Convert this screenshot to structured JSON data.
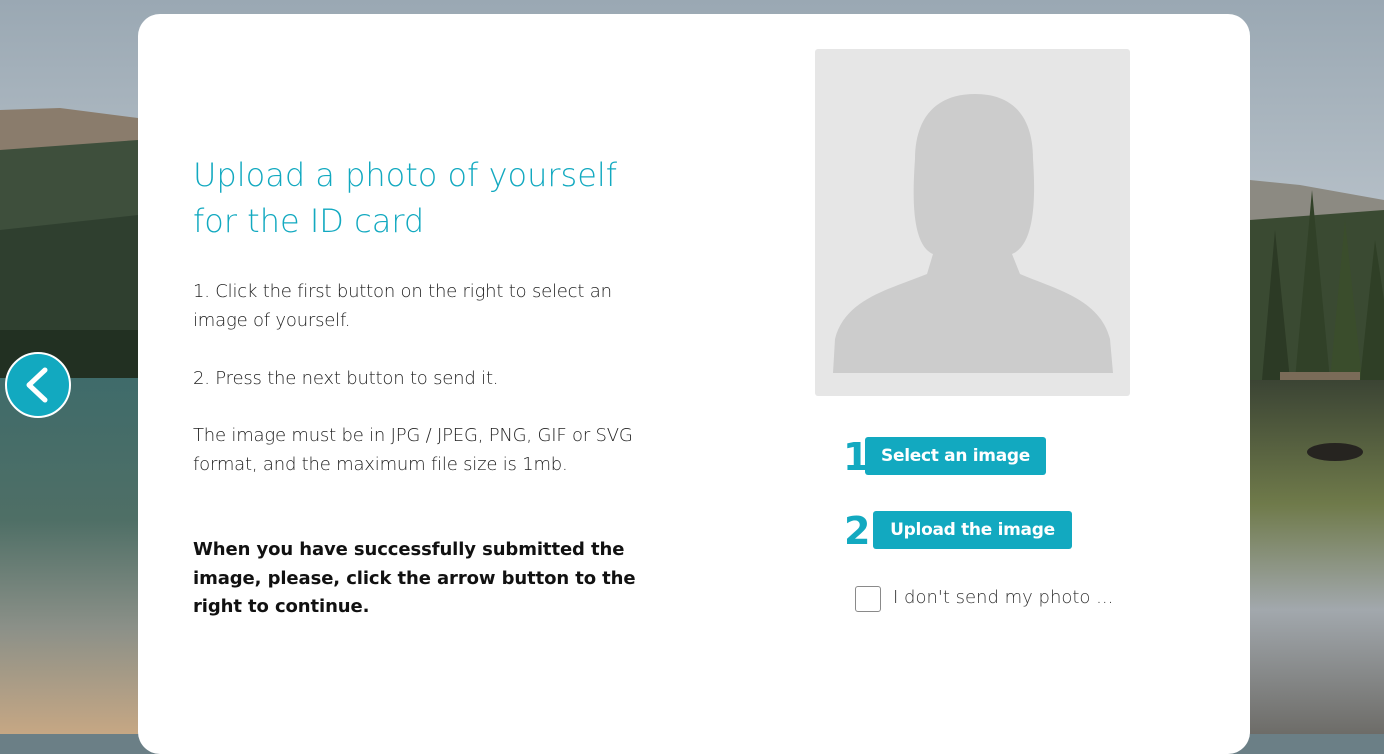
{
  "heading": "Upload a photo of yourself for the ID card",
  "instructions": {
    "step1": "1. Click the first button on the right to select an image of yourself.",
    "step2": "2. Press the next button to send it.",
    "format_note": "The image must be in JPG / JPEG, PNG, GIF or SVG format, and the maximum file size is 1mb.",
    "continue_note": "When you have successfully submitted the image, please, click the arrow button to the right to continue."
  },
  "photo_placeholder": {
    "icon": "person-silhouette-icon"
  },
  "buttons": {
    "step1_number": "1",
    "select_label": "Select an image",
    "step2_number": "2",
    "upload_label": "Upload the image"
  },
  "checkbox": {
    "label": "I don't send my photo ...",
    "checked": false
  },
  "navigation": {
    "back_icon": "chevron-left-icon"
  },
  "colors": {
    "accent": "#12a9c0",
    "placeholder_bg": "#e6e6e6",
    "silhouette": "#cccccc"
  }
}
